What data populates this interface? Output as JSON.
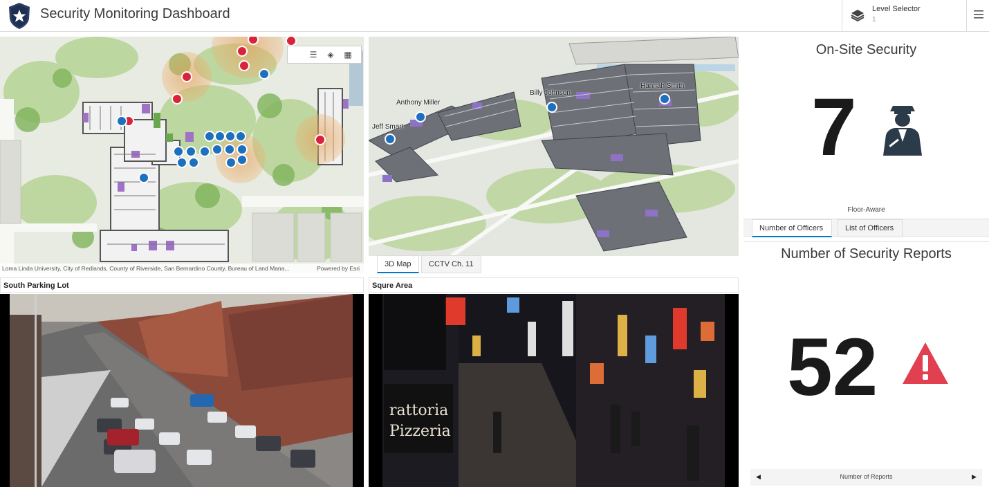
{
  "header": {
    "title": "Security Monitoring Dashboard",
    "level_selector_label": "Level Selector",
    "level_selector_value": "1"
  },
  "map2d": {
    "attribution": "Loma Linda University, City of Redlands, County of Riverside, San Bernardino County, Bureau of Land Mana...",
    "powered_by": "Powered by Esri"
  },
  "map3d": {
    "officers": [
      "Anthony Miller",
      "Billy Johnson",
      "Hannah Smith",
      "Jeff Smart"
    ]
  },
  "map_tabs": [
    "3D Map",
    "CCTV Ch. 11"
  ],
  "cameras": {
    "south": "South Parking Lot",
    "square": "Squre Area"
  },
  "onsite": {
    "title": "On-Site Security",
    "count": "7",
    "footer": "Floor-Aware",
    "tabs": [
      "Number of Officers",
      "List of Officers"
    ]
  },
  "reports": {
    "title": "Number of Security Reports",
    "count": "52",
    "footer": "Number of Reports"
  },
  "colors": {
    "accent": "#0079c1",
    "alert": "#e0404f",
    "officer_pin": "#1f6fbf"
  }
}
